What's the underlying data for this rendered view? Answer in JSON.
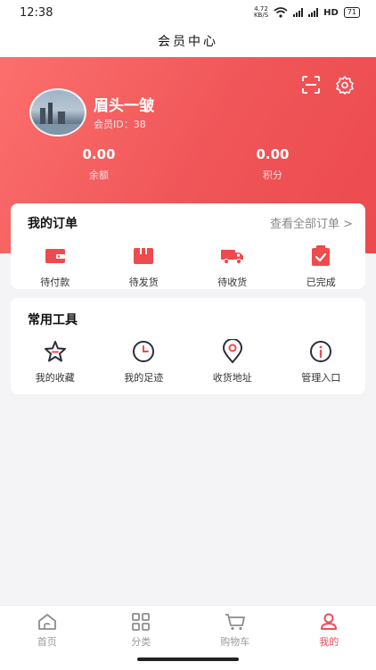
{
  "status_bar": {
    "time": "12:38",
    "net_speed_value": "4.72",
    "net_speed_unit": "KB/S",
    "hd_label": "HD",
    "battery": "71"
  },
  "header": {
    "title": "会员中心"
  },
  "user": {
    "name": "眉头一皱",
    "member_id_label": "会员ID：38"
  },
  "stats": [
    {
      "value": "0.00",
      "label": "余额"
    },
    {
      "value": "0.00",
      "label": "积分"
    }
  ],
  "orders": {
    "title": "我的订单",
    "view_all": "查看全部订单 >",
    "items": [
      {
        "label": "待付款",
        "icon": "wallet-icon"
      },
      {
        "label": "待发货",
        "icon": "package-icon"
      },
      {
        "label": "待收货",
        "icon": "truck-icon"
      },
      {
        "label": "已完成",
        "icon": "check-clipboard-icon"
      }
    ]
  },
  "tools": {
    "title": "常用工具",
    "items": [
      {
        "label": "我的收藏",
        "icon": "star-icon"
      },
      {
        "label": "我的足迹",
        "icon": "clock-icon"
      },
      {
        "label": "收货地址",
        "icon": "location-pin-icon"
      },
      {
        "label": "管理入口",
        "icon": "info-icon"
      }
    ]
  },
  "nav": {
    "items": [
      {
        "label": "首页",
        "icon": "home-icon"
      },
      {
        "label": "分类",
        "icon": "category-icon"
      },
      {
        "label": "购物车",
        "icon": "cart-icon"
      },
      {
        "label": "我的",
        "icon": "profile-icon",
        "active": true
      }
    ]
  },
  "colors": {
    "accent": "#ef4c5b",
    "hero_start": "#fb6f6d",
    "hero_end": "#ec4a4e"
  }
}
